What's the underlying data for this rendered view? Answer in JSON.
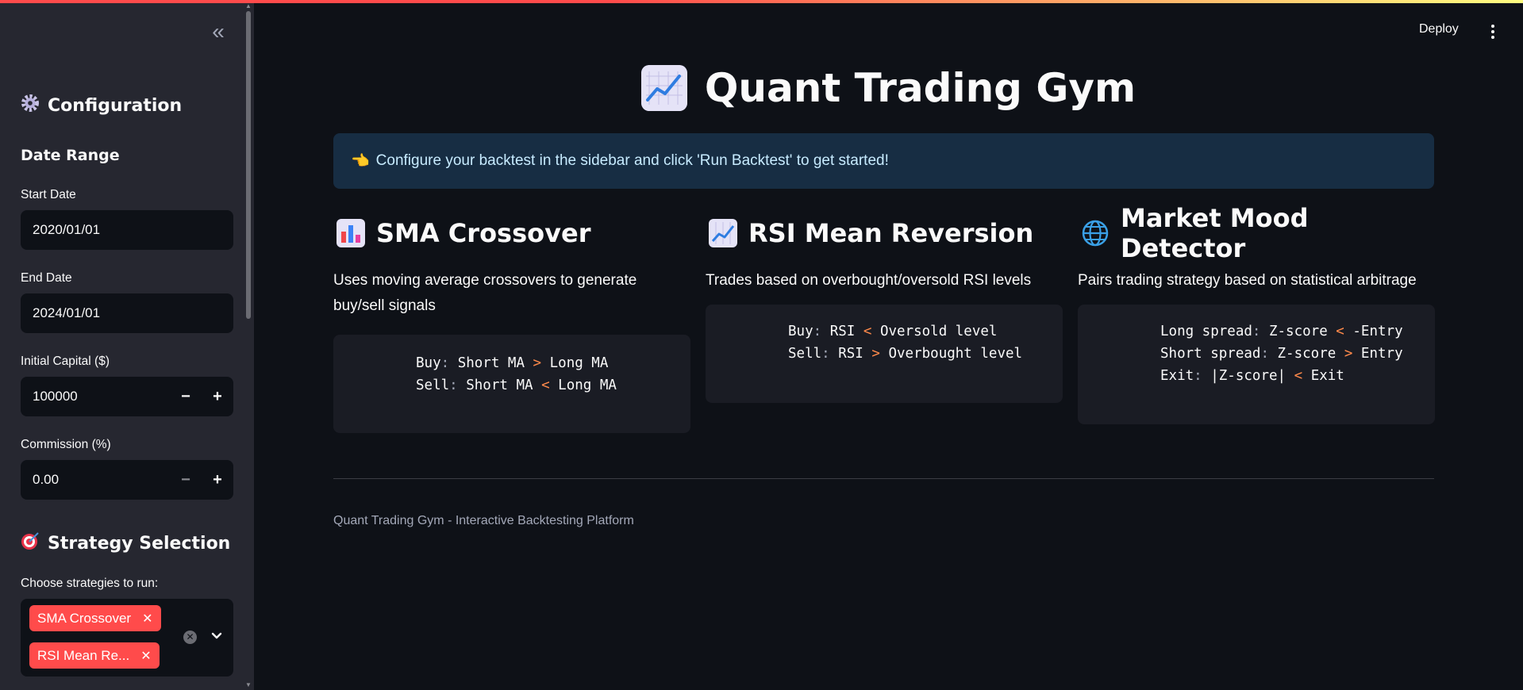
{
  "header": {
    "deploy_label": "Deploy"
  },
  "sidebar": {
    "configuration_title": "Configuration",
    "date_range_title": "Date Range",
    "start_date": {
      "label": "Start Date",
      "value": "2020/01/01"
    },
    "end_date": {
      "label": "End Date",
      "value": "2024/01/01"
    },
    "initial_capital": {
      "label": "Initial Capital ($)",
      "value": "100000"
    },
    "commission": {
      "label": "Commission (%)",
      "value": "0.00"
    },
    "strategy_title": "Strategy Selection",
    "strategies_label": "Choose strategies to run:",
    "selected_strategies": [
      "SMA Crossover",
      "RSI Mean Re..."
    ]
  },
  "main": {
    "title": "Quant Trading Gym",
    "info": "Configure your backtest in the sidebar and click 'Run Backtest' to get started!",
    "columns": [
      {
        "title": "SMA Crossover",
        "icon": "bar-chart-icon",
        "description": "Uses moving average crossovers to generate buy/sell signals",
        "code": [
          {
            "key": "Buy",
            "left": "Short MA",
            "op": ">",
            "right": "Long MA"
          },
          {
            "key": "Sell",
            "left": "Short MA",
            "op": "<",
            "right": "Long MA"
          }
        ]
      },
      {
        "title": "RSI Mean Reversion",
        "icon": "chart-increasing-icon",
        "description": "Trades based on overbought/oversold RSI levels",
        "code": [
          {
            "key": "Buy",
            "left": "RSI",
            "op": "<",
            "right": "Oversold level"
          },
          {
            "key": "Sell",
            "left": "RSI",
            "op": ">",
            "right": "Overbought level"
          }
        ]
      },
      {
        "title": "Market Mood Detector",
        "icon": "globe-icon",
        "description": "Pairs trading strategy based on statistical arbitrage",
        "code": [
          {
            "key": "Long spread",
            "left": "Z-score",
            "op": "<",
            "right": "-Entry"
          },
          {
            "key": "Short spread",
            "left": "Z-score",
            "op": ">",
            "right": "Entry"
          },
          {
            "key": "Exit",
            "left": "|Z-score|",
            "op": "<",
            "right": "Exit"
          }
        ]
      }
    ],
    "footer": "Quant Trading Gym - Interactive Backtesting Platform"
  },
  "colors": {
    "accent": "#ff4b4b",
    "background": "#0e1117",
    "sidebar": "#262730",
    "info_bg": "#172d43",
    "operator": "#ff8a4b"
  }
}
